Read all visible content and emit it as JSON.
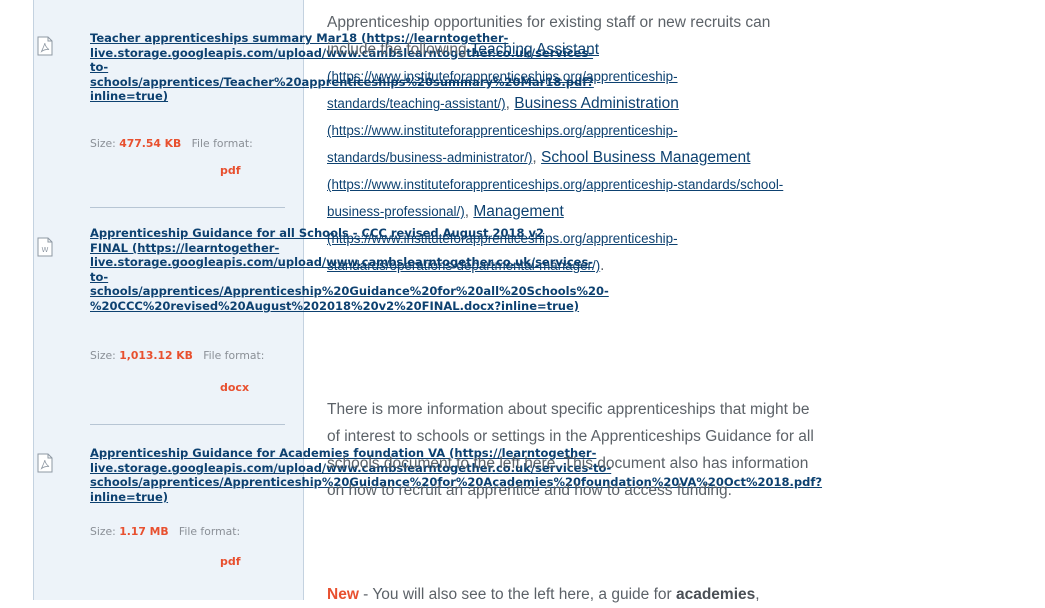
{
  "sidebar": {
    "files": [
      {
        "title_lines": [
          "Teacher apprenticeships summary Mar18 (https://learntogether-",
          "live.storage.googleapis.com/upload/www.cambslearntogether.co.uk/services-",
          "to-",
          "schools/apprentices/Teacher%20apprenticeships%20summary%20Mar18.pdf?",
          "inline=true)"
        ],
        "size_label": "Size:",
        "size_value": "477.54 KB",
        "format_label": "File format:",
        "format_value": "pdf",
        "icon": "pdf-file-icon"
      },
      {
        "title_lines": [
          "Apprenticeship Guidance for all Schools - CCC revised August 2018 v2",
          "FINAL (https://learntogether-",
          "live.storage.googleapis.com/upload/www.cambslearntogether.co.uk/services-",
          "to-",
          "schools/apprentices/Apprenticeship%20Guidance%20for%20all%20Schools%20-",
          "%20CCC%20revised%20August%202018%20v2%20FINAL.docx?inline=true)"
        ],
        "size_label": "Size:",
        "size_value": "1,013.12 KB",
        "format_label": "File format:",
        "format_value": "docx",
        "icon": "word-file-icon"
      },
      {
        "title_lines": [
          "Apprenticeship Guidance for Academies foundation VA (https://learntogether-",
          "live.storage.googleapis.com/upload/www.cambslearntogether.co.uk/services-to-",
          "schools/apprentices/Apprenticeship%20Guidance%20for%20Academies%20foundation%20VA%20Oct%2018.pdf?",
          "inline=true)"
        ],
        "size_label": "Size:",
        "size_value": "1.17 MB",
        "format_label": "File format:",
        "format_value": "pdf",
        "icon": "pdf-file-icon"
      }
    ]
  },
  "main": {
    "p1": {
      "intro": "Apprenticeship opportunities for existing staff or new recruits can",
      "line2_text": "include the following ",
      "link1": "Teaching Assistant",
      "link1_url_a": "(https://www.instituteforapprenticeships.org/apprenticeship-",
      "link1_url_b": "standards/teaching-assistant/)",
      "link2": "Business Administration",
      "link2_url_a": "(https://www.instituteforapprenticeships.org/apprenticeship-",
      "link2_url_b": "standards/business-administrator/)",
      "link3": "School Business Management",
      "link3_url": "(https://www.instituteforapprenticeships.org/apprenticeship-standards/school-",
      "link3_url_b": "business-professional/)",
      "link4": "Management",
      "link4_url_a": "(https://www.instituteforapprenticeships.org/apprenticeship-",
      "link4_url_b": "standards/operations-departmental-manager/)"
    },
    "p2": {
      "line1": "There is more information about specific apprenticeships that might be",
      "line2": "of interest to schools or settings in the Apprenticeships Guidance for all",
      "line3": "schools document to the left here. This document also has information",
      "line4": "on how to recruit an apprentice and how to access funding."
    },
    "p3": {
      "new_label": "New",
      "text_a": " - You will also see to the left here, a guide for ",
      "academies": "academies",
      "text_b": ","
    }
  }
}
